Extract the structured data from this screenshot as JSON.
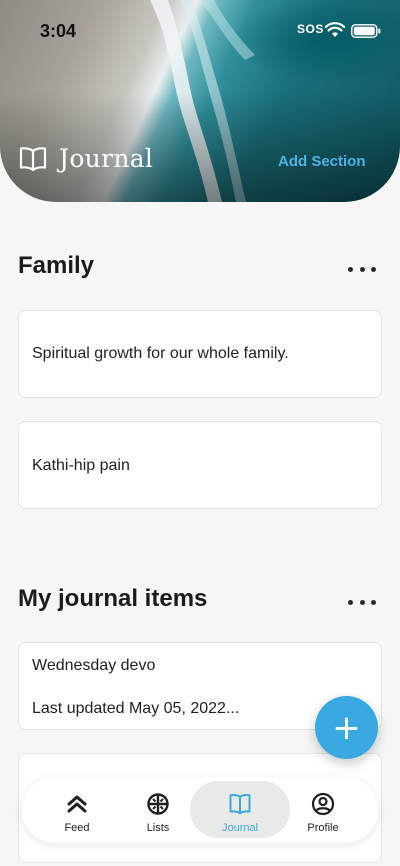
{
  "status_bar": {
    "time": "3:04",
    "sos": "SOS"
  },
  "header": {
    "title": "Journal",
    "add_section_label": "Add Section",
    "accent_color": "#4fb2e5"
  },
  "sections": [
    {
      "title": "Family",
      "items": [
        {
          "text": "Spiritual growth for our whole family."
        },
        {
          "text": "Kathi-hip pain"
        }
      ]
    },
    {
      "title": "My journal items",
      "items": [
        {
          "title": "Wednesday devo",
          "subtitle": "Last updated May 05, 2022..."
        }
      ]
    }
  ],
  "fab": {
    "icon": "plus-icon",
    "glyph": "+"
  },
  "bottom_nav": {
    "items": [
      {
        "label": "Feed",
        "icon": "feed-icon"
      },
      {
        "label": "Lists",
        "icon": "lists-icon"
      },
      {
        "label": "Journal",
        "icon": "journal-icon",
        "active": true
      },
      {
        "label": "Profile",
        "icon": "profile-icon"
      }
    ],
    "active_color": "#3fa7dc"
  }
}
